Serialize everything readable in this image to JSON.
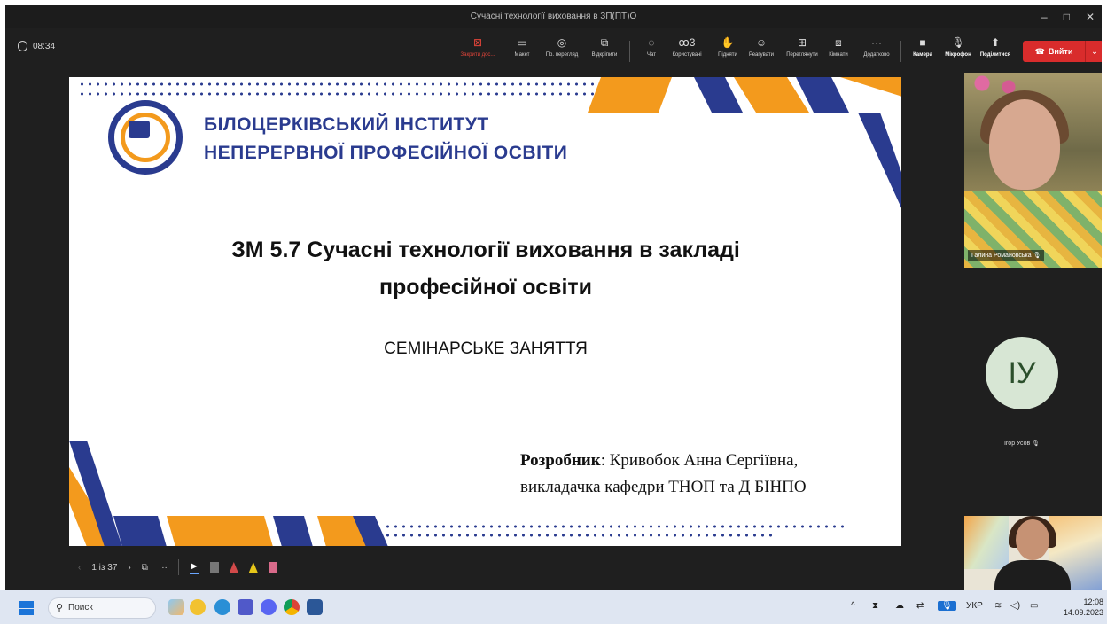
{
  "window": {
    "title": "Сучасні технології виховання в ЗП(ПТ)О",
    "controls": [
      "–",
      "□",
      "✕"
    ]
  },
  "meeting": {
    "timer": "08:34",
    "toolbar": [
      {
        "label": "Закрити дос...",
        "icon": "close-share-icon",
        "glyph": "⊠"
      },
      {
        "label": "Макет",
        "icon": "layout-icon",
        "glyph": "▭"
      },
      {
        "label": "Пр. перегляд",
        "icon": "preview-icon",
        "glyph": "◎"
      },
      {
        "label": "Відкріпити",
        "icon": "unpin-icon",
        "glyph": "⧉"
      },
      {
        "label": "Чат",
        "icon": "chat-icon",
        "glyph": "◌"
      },
      {
        "label": "Користувачі",
        "icon": "people-icon",
        "glyph": "ꝏ3"
      },
      {
        "label": "Підняти",
        "icon": "raise-hand-icon",
        "glyph": "✋"
      },
      {
        "label": "Реагувати",
        "icon": "react-icon",
        "glyph": "☺"
      },
      {
        "label": "Переглянути",
        "icon": "view-icon",
        "glyph": "⊞"
      },
      {
        "label": "Кімнати",
        "icon": "rooms-icon",
        "glyph": "⧈"
      },
      {
        "label": "Додатково",
        "icon": "more-icon",
        "glyph": "···"
      },
      {
        "label": "Камера",
        "icon": "camera-icon",
        "glyph": "■"
      },
      {
        "label": "Мікрофон",
        "icon": "microphone-icon",
        "glyph": "🎙"
      },
      {
        "label": "Поділитися",
        "icon": "share-icon",
        "glyph": "⬆"
      }
    ],
    "leave_label": "Вийти"
  },
  "slide": {
    "institute_line1": "БІЛОЦЕРКІВСЬКИЙ ІНСТИТУТ",
    "institute_line2": "НЕПЕРЕРВНОЇ ПРОФЕСІЙНОЇ ОСВІТИ",
    "title_line1": "ЗМ 5.7 Сучасні технології виховання в закладі",
    "title_line2": "професійної освіти",
    "subtitle": "СЕМІНАРСЬКЕ ЗАНЯТТЯ",
    "author_label": "Розробник",
    "author_name": ": Кривобок Анна Сергіївна,",
    "author_role": "викладачка кафедри ТНОП та Д БІНПО",
    "accent_orange": "#f39a1d",
    "accent_blue": "#2a3b8f"
  },
  "slide_nav": {
    "counter": "1 із 37"
  },
  "participants": [
    {
      "name": "Галина Романовська"
    },
    {
      "name": "Ігор Усов",
      "initials": "ІУ"
    }
  ],
  "taskbar": {
    "search_placeholder": "Поиск",
    "language": "УКР",
    "time": "12:08",
    "date": "14.09.2023"
  }
}
